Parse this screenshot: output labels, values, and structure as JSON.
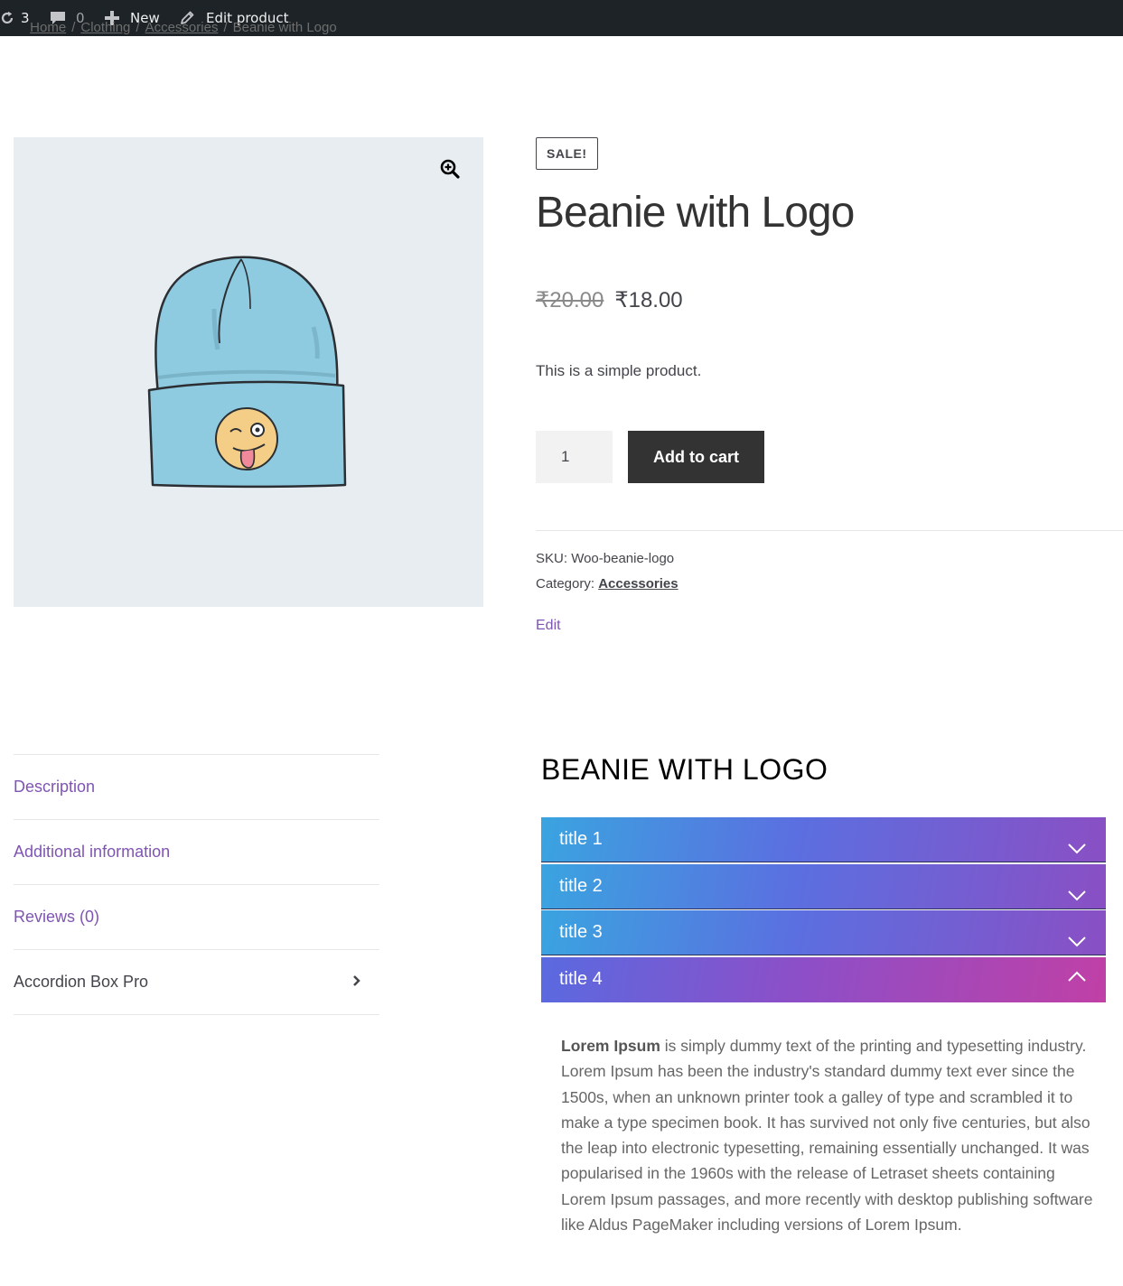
{
  "admin_bar": {
    "updates_count": "3",
    "comments_count": "0",
    "new_label": "New",
    "edit_label": "Edit product"
  },
  "breadcrumb": {
    "items": [
      "Home",
      "Clothing",
      "Accessories",
      "Beanie with Logo"
    ]
  },
  "product": {
    "sale_badge": "SALE!",
    "title": "Beanie with Logo",
    "old_price": "₹20.00",
    "new_price": "₹18.00",
    "short_description": "This is a simple product.",
    "quantity": "1",
    "add_to_cart_label": "Add to cart",
    "sku_label": "SKU:",
    "sku_value": "Woo-beanie-logo",
    "category_label": "Category:",
    "category_value": "Accessories",
    "edit_label": "Edit"
  },
  "tabs": [
    {
      "label": "Description"
    },
    {
      "label": "Additional information"
    },
    {
      "label": "Reviews (0)"
    },
    {
      "label": "Accordion Box Pro"
    }
  ],
  "accordion": {
    "heading": "BEANIE WITH LOGO",
    "items": [
      {
        "title": "title 1",
        "state": "collapsed"
      },
      {
        "title": "title 2",
        "state": "collapsed"
      },
      {
        "title": "title 3",
        "state": "collapsed"
      },
      {
        "title": "title 4",
        "state": "expanded"
      }
    ],
    "content_bold": "Lorem Ipsum",
    "content_rest": " is simply dummy text of the printing and typesetting industry. Lorem Ipsum has been the industry's standard dummy text ever since the 1500s, when an unknown printer took a galley of type and scrambled it to make a type specimen book. It has survived not only five centuries, but also the leap into electronic typesetting, remaining essentially unchanged. It was popularised in the 1960s with the release of Letraset sheets containing Lorem Ipsum passages, and more recently with desktop publishing software like Aldus PageMaker including versions of Lorem Ipsum."
  },
  "colors": {
    "admin_bar_bg": "#1d2327",
    "link_purple": "#7f54b3",
    "button_bg": "#333333",
    "gallery_bg": "#e7edf1",
    "beanie_blue": "#8fcbe0"
  },
  "icons": {
    "updates": "refresh-icon",
    "comments": "comment-icon",
    "new": "plus-icon",
    "edit": "pencil-icon",
    "zoom": "zoom-in-icon",
    "tab_arrow": "chevron-right-icon",
    "accordion_collapsed": "chevron-down-icon",
    "accordion_expanded": "chevron-up-icon"
  }
}
